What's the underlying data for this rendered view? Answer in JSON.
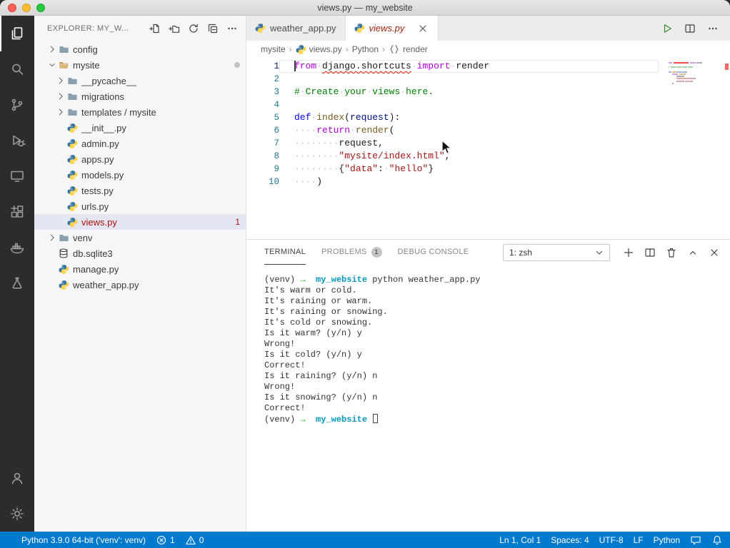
{
  "window": {
    "title": "views.py — my_website"
  },
  "colors": {
    "status_bar": "#007acc",
    "error_red": "#b01011",
    "python_blue": "#3673a5",
    "python_yellow": "#ffd343",
    "selection": "#e4e6f1"
  },
  "activity_bar": {
    "top": [
      {
        "name": "explorer",
        "active": true
      },
      {
        "name": "search",
        "active": false
      },
      {
        "name": "source-control",
        "active": false
      },
      {
        "name": "run-and-debug",
        "active": false
      },
      {
        "name": "remote-explorer",
        "active": false
      },
      {
        "name": "extensions",
        "active": false
      },
      {
        "name": "docker",
        "active": false
      },
      {
        "name": "testing",
        "active": false
      }
    ],
    "bottom": [
      {
        "name": "accounts",
        "active": false
      },
      {
        "name": "manage",
        "active": false
      }
    ]
  },
  "explorer": {
    "header": "EXPLORER: MY_W...",
    "toolbar": [
      {
        "name": "new-file",
        "icon": "new-file"
      },
      {
        "name": "new-folder",
        "icon": "new-folder"
      },
      {
        "name": "refresh-explorer",
        "icon": "refresh"
      },
      {
        "name": "collapse-folders",
        "icon": "collapse-all"
      },
      {
        "name": "more-actions",
        "icon": "more"
      }
    ],
    "tree": [
      {
        "label": "config",
        "depth": 1,
        "kind": "folder",
        "icon": "folder",
        "expanded": false
      },
      {
        "label": "mysite",
        "depth": 1,
        "kind": "folder",
        "icon": "folder-open",
        "expanded": true,
        "dot": true
      },
      {
        "label": "__pycache__",
        "depth": 2,
        "kind": "folder",
        "icon": "folder",
        "expanded": false
      },
      {
        "label": "migrations",
        "depth": 2,
        "kind": "folder",
        "icon": "folder",
        "expanded": false
      },
      {
        "label": "templates / mysite",
        "depth": 2,
        "kind": "folder",
        "icon": "folder",
        "expanded": false
      },
      {
        "label": "__init__.py",
        "depth": 2,
        "kind": "file",
        "icon": "python"
      },
      {
        "label": "admin.py",
        "depth": 2,
        "kind": "file",
        "icon": "python"
      },
      {
        "label": "apps.py",
        "depth": 2,
        "kind": "file",
        "icon": "python"
      },
      {
        "label": "models.py",
        "depth": 2,
        "kind": "file",
        "icon": "python"
      },
      {
        "label": "tests.py",
        "depth": 2,
        "kind": "file",
        "icon": "python"
      },
      {
        "label": "urls.py",
        "depth": 2,
        "kind": "file",
        "icon": "python"
      },
      {
        "label": "views.py",
        "depth": 2,
        "kind": "file",
        "icon": "python",
        "selected": true,
        "error": true,
        "badge": "1"
      },
      {
        "label": "venv",
        "depth": 1,
        "kind": "folder",
        "icon": "folder",
        "expanded": false
      },
      {
        "label": "db.sqlite3",
        "depth": 1,
        "kind": "file",
        "icon": "database"
      },
      {
        "label": "manage.py",
        "depth": 1,
        "kind": "file",
        "icon": "python"
      },
      {
        "label": "weather_app.py",
        "depth": 1,
        "kind": "file",
        "icon": "python"
      }
    ]
  },
  "editor": {
    "tabs": [
      {
        "label": "weather_app.py",
        "icon": "python",
        "active": false
      },
      {
        "label": "views.py",
        "icon": "python",
        "active": true,
        "error": true,
        "close": "close"
      }
    ],
    "actions": [
      {
        "name": "run-python-file",
        "icon": "run"
      },
      {
        "name": "split-editor",
        "icon": "split"
      },
      {
        "name": "more-editor-actions",
        "icon": "more"
      }
    ],
    "breadcrumb_separator": "›",
    "breadcrumbs": [
      {
        "label": "mysite"
      },
      {
        "label": "views.py",
        "icon": "python"
      },
      {
        "label": "Python"
      },
      {
        "label": "render",
        "icon": "braces"
      }
    ],
    "code_lines": [
      {
        "num": "1",
        "current": true,
        "tokens": [
          {
            "c": "cursor"
          },
          {
            "t": "from",
            "c": "kw"
          },
          {
            "t": "·",
            "c": "ws"
          },
          {
            "t": "django.shortcuts",
            "c": "plain err"
          },
          {
            "t": "·",
            "c": "ws"
          },
          {
            "t": "import",
            "c": "kw"
          },
          {
            "t": "·",
            "c": "ws"
          },
          {
            "t": "render",
            "c": "plain"
          }
        ]
      },
      {
        "num": "2",
        "tokens": []
      },
      {
        "num": "3",
        "tokens": [
          {
            "t": "#",
            "c": "cmt"
          },
          {
            "t": "·",
            "c": "ws"
          },
          {
            "t": "Create",
            "c": "cmt"
          },
          {
            "t": "·",
            "c": "ws"
          },
          {
            "t": "your",
            "c": "cmt"
          },
          {
            "t": "·",
            "c": "ws"
          },
          {
            "t": "views",
            "c": "cmt"
          },
          {
            "t": "·",
            "c": "ws"
          },
          {
            "t": "here.",
            "c": "cmt"
          }
        ]
      },
      {
        "num": "4",
        "tokens": []
      },
      {
        "num": "5",
        "tokens": [
          {
            "t": "def",
            "c": "kw2"
          },
          {
            "t": "·",
            "c": "ws"
          },
          {
            "t": "index",
            "c": "fn"
          },
          {
            "t": "(",
            "c": "plain"
          },
          {
            "t": "request",
            "c": "param"
          },
          {
            "t": "):",
            "c": "plain"
          }
        ]
      },
      {
        "num": "6",
        "tokens": [
          {
            "t": "····",
            "c": "ws"
          },
          {
            "t": "return",
            "c": "kw"
          },
          {
            "t": "·",
            "c": "ws"
          },
          {
            "t": "render",
            "c": "fn"
          },
          {
            "t": "(",
            "c": "plain"
          }
        ]
      },
      {
        "num": "7",
        "tokens": [
          {
            "t": "········",
            "c": "ws"
          },
          {
            "t": "request,",
            "c": "plain"
          }
        ]
      },
      {
        "num": "8",
        "tokens": [
          {
            "t": "········",
            "c": "ws"
          },
          {
            "t": "\"mysite/index.html\"",
            "c": "str"
          },
          {
            "t": ",",
            "c": "plain"
          }
        ]
      },
      {
        "num": "9",
        "tokens": [
          {
            "t": "········",
            "c": "ws"
          },
          {
            "t": "{",
            "c": "plain"
          },
          {
            "t": "\"data\"",
            "c": "str"
          },
          {
            "t": ":",
            "c": "plain"
          },
          {
            "t": "·",
            "c": "ws"
          },
          {
            "t": "\"hello\"",
            "c": "str"
          },
          {
            "t": "}",
            "c": "plain"
          }
        ]
      },
      {
        "num": "10",
        "tokens": [
          {
            "t": "····",
            "c": "ws"
          },
          {
            "t": ")",
            "c": "plain"
          }
        ]
      }
    ]
  },
  "terminal": {
    "tabs": [
      {
        "label": "TERMINAL",
        "active": true
      },
      {
        "label": "PROBLEMS",
        "badge": "1"
      },
      {
        "label": "DEBUG CONSOLE"
      }
    ],
    "shell_select": "1: zsh",
    "actions": [
      {
        "name": "new-terminal",
        "icon": "plus"
      },
      {
        "name": "split-terminal",
        "icon": "split"
      },
      {
        "name": "kill-terminal",
        "icon": "trash"
      },
      {
        "name": "maximize-panel",
        "icon": "chevron-up"
      },
      {
        "name": "close-panel",
        "icon": "close"
      }
    ],
    "lines": [
      [
        {
          "t": "(venv) ",
          "c": "p"
        },
        {
          "t": "→",
          "c": "arrow"
        },
        {
          "t": "  ",
          "c": "p"
        },
        {
          "t": "my_website",
          "c": "dir"
        },
        {
          "t": " python weather_app.py",
          "c": "p"
        }
      ],
      [
        {
          "t": "It's warm or cold.",
          "c": "p"
        }
      ],
      [
        {
          "t": "It's raining or warm.",
          "c": "p"
        }
      ],
      [
        {
          "t": "It's raining or snowing.",
          "c": "p"
        }
      ],
      [
        {
          "t": "It's cold or snowing.",
          "c": "p"
        }
      ],
      [
        {
          "t": "Is it warm? (y/n) y",
          "c": "p"
        }
      ],
      [
        {
          "t": "Wrong!",
          "c": "p"
        }
      ],
      [
        {
          "t": "Is it cold? (y/n) y",
          "c": "p"
        }
      ],
      [
        {
          "t": "Correct!",
          "c": "p"
        }
      ],
      [
        {
          "t": "Is it raining? (y/n) n",
          "c": "p"
        }
      ],
      [
        {
          "t": "Wrong!",
          "c": "p"
        }
      ],
      [
        {
          "t": "Is it snowing? (y/n) n",
          "c": "p"
        }
      ],
      [
        {
          "t": "Correct!",
          "c": "p"
        }
      ],
      [
        {
          "t": "(venv) ",
          "c": "p"
        },
        {
          "t": "→",
          "c": "arrow"
        },
        {
          "t": "  ",
          "c": "p"
        },
        {
          "t": "my_website",
          "c": "dir"
        },
        {
          "t": " ",
          "c": "p"
        },
        {
          "c": "cursor"
        }
      ]
    ]
  },
  "status_bar": {
    "left": [
      {
        "name": "python-interpreter",
        "text": "Python 3.9.0 64-bit ('venv': venv)"
      },
      {
        "name": "error-count",
        "icon": "error",
        "text": "1"
      },
      {
        "name": "warning-count",
        "icon": "warning",
        "text": "0"
      }
    ],
    "right": [
      {
        "name": "cursor-position",
        "text": "Ln 1, Col 1"
      },
      {
        "name": "indentation",
        "text": "Spaces: 4"
      },
      {
        "name": "encoding",
        "text": "UTF-8"
      },
      {
        "name": "eol-sequence",
        "text": "LF"
      },
      {
        "name": "language-mode",
        "text": "Python"
      },
      {
        "name": "feedback",
        "icon": "feedback"
      },
      {
        "name": "notifications",
        "icon": "bell"
      }
    ]
  }
}
